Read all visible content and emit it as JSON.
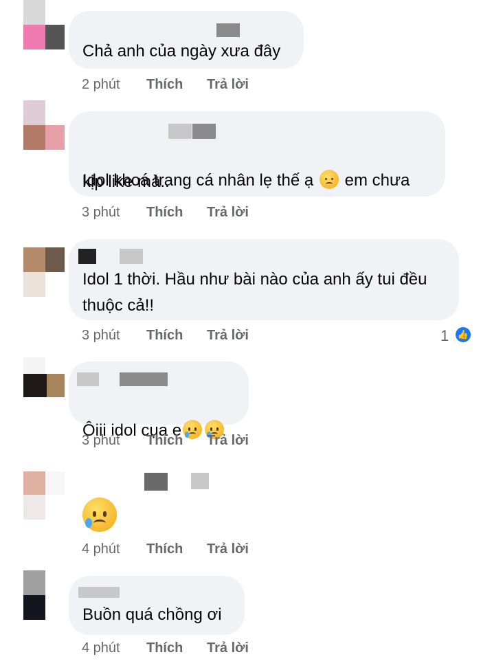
{
  "comments": [
    {
      "text": "Chả anh của ngày xưa đây",
      "time": "2 phút",
      "like": "Thích",
      "reply": "Trả lời"
    },
    {
      "text_a": "Idol khoá trang cá nhân lẹ thế ạ ",
      "text_b": " em chưa",
      "text_c": "kịp like mà..",
      "time": "3 phút",
      "like": "Thích",
      "reply": "Trả lời",
      "emoji": "disappointed-face-icon"
    },
    {
      "text": "Idol 1 thời. Hầu như bài nào của anh ấy tui đều\nthuộc cả!!",
      "time": "3 phút",
      "like": "Thích",
      "reply": "Trả lời",
      "reaction_count": "1",
      "reaction_icon": "thumbs-up-icon"
    },
    {
      "text": "Ôiii idol cụa e",
      "time": "3 phút",
      "like": "Thích",
      "reply": "Trả lời",
      "emoji": "crying-face-icon"
    },
    {
      "time": "4 phút",
      "like": "Thích",
      "reply": "Trả lời",
      "emoji": "sad-sweat-face-icon"
    },
    {
      "text": "Buồn quá chồng ơi",
      "time": "4 phút",
      "like": "Thích",
      "reply": "Trả lời"
    }
  ],
  "colors": {
    "bubble": "#f0f2f5",
    "meta": "#65676b",
    "text": "#050505",
    "like_blue": "#1877f2"
  }
}
